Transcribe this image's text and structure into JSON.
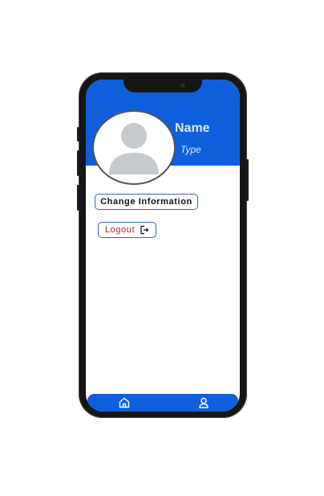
{
  "profile": {
    "name": "Name",
    "type": "Type"
  },
  "actions": {
    "change_information_label": "Change Information",
    "logout_label": "Logout"
  },
  "bottom_nav": {
    "items": [
      {
        "icon": "home-icon"
      },
      {
        "icon": "user-icon"
      }
    ]
  },
  "colors": {
    "brand_blue": "#0f5fdc",
    "logout_red": "#b21f1f",
    "button_border": "#2c66c4"
  }
}
